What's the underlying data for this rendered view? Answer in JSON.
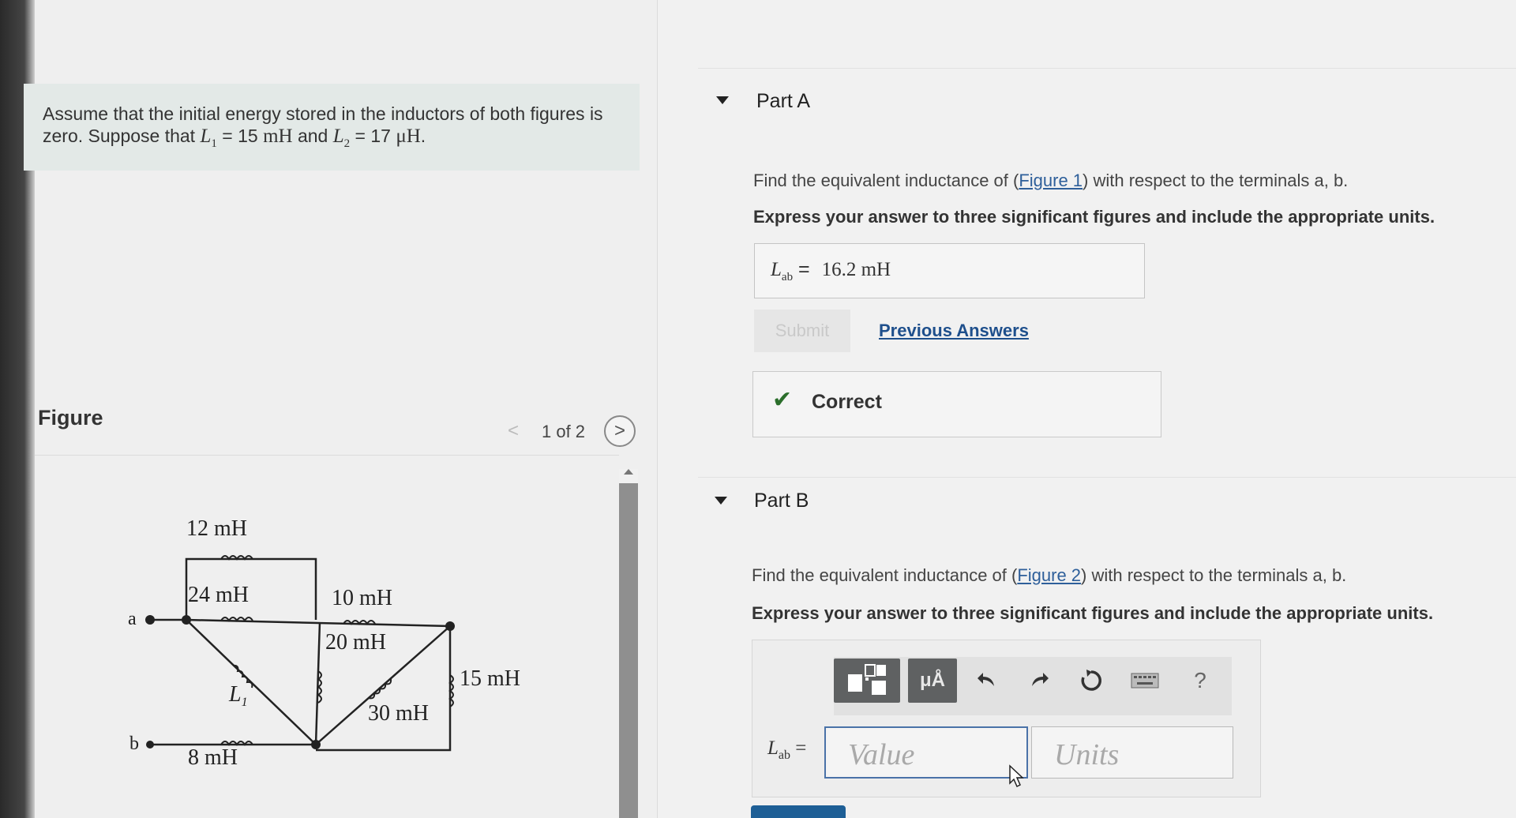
{
  "problem": {
    "line1": "Assume that the initial energy stored in the inductors of both figures is",
    "line2_prefix": "zero. Suppose that ",
    "L1_symbol": "L",
    "L1_sub": "1",
    "L1_value": "= 15",
    "L1_unit": "mH",
    "and": "and",
    "L2_symbol": "L",
    "L2_sub": "2",
    "L2_value": "= 17",
    "L2_unit": "μH",
    "end": "."
  },
  "figure": {
    "heading": "Figure",
    "prev_symbol": "<",
    "next_symbol": ">",
    "page_indicator": "1 of 2",
    "circuit_labels": {
      "l12": "12 mH",
      "l24": "24 mH",
      "l10": "10 mH",
      "l20": "20 mH",
      "l15": "15 mH",
      "l30": "30 mH",
      "l8": "8 mH",
      "L1": "L",
      "L1_sub": "1",
      "term_a": "a",
      "term_b": "b"
    }
  },
  "partA": {
    "title": "Part A",
    "question_pre": "Find the equivalent inductance of (",
    "question_link": "Figure 1",
    "question_post": ") with respect to the terminals a, b.",
    "instruction": "Express your answer to three significant figures and include the appropriate units.",
    "answer_symbol": "L",
    "answer_sub": "ab",
    "answer_eq": "=",
    "answer_value": "16.2 mH",
    "submit_label": "Submit",
    "previous_answers": "Previous Answers",
    "feedback_check": "✔",
    "feedback": "Correct"
  },
  "partB": {
    "title": "Part B",
    "question_pre": "Find the equivalent inductance of (",
    "question_link": "Figure 2",
    "question_post": ") with respect to the terminals a, b.",
    "instruction": "Express your answer to three significant figures and include the appropriate units.",
    "toolbar": {
      "units_button": "μÅ",
      "help": "?"
    },
    "input_symbol": "L",
    "input_sub": "ab",
    "input_eq": "=",
    "value_placeholder": "Value",
    "units_placeholder": "Units"
  }
}
